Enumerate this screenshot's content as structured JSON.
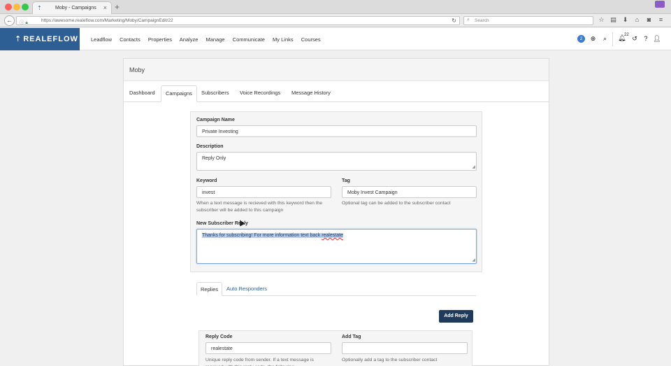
{
  "browser": {
    "tab_title": "Moby - Campaigns",
    "url": "https://awesome.realeflow.com/Marketing/Moby/CampaignEdit/22",
    "search_placeholder": "Search",
    "icons": [
      "star-icon",
      "reader-icon",
      "download-icon",
      "home-icon",
      "pocket-icon",
      "menu-icon"
    ]
  },
  "app": {
    "logo": "REALEFLOW",
    "nav": [
      "Leadflow",
      "Contacts",
      "Properties",
      "Analyze",
      "Manage",
      "Communicate",
      "My Links",
      "Courses"
    ],
    "badge_count": "2",
    "notification_count": "22"
  },
  "page": {
    "title": "Moby",
    "tabs": [
      "Dashboard",
      "Campaigns",
      "Subscribers",
      "Voice Recordings",
      "Message History"
    ],
    "active_tab": "Campaigns"
  },
  "form": {
    "campaign_name_label": "Campaign Name",
    "campaign_name_value": "Private Investing",
    "description_label": "Description",
    "description_value": "Reply Only",
    "keyword_label": "Keyword",
    "keyword_value": "invest",
    "keyword_hint": "When a text message is recieved with this keyword then the subscriber will be added to this campaign",
    "tag_label": "Tag",
    "tag_value": "Moby Invest Campaign",
    "tag_hint": "Optional tag can be added to the subscriber contact",
    "new_subscriber_reply_label": "New Subscriber Reply",
    "new_subscriber_reply_value_a": "Thanks for subscribing! For more information text back ",
    "new_subscriber_reply_value_b": "realestate"
  },
  "subtabs": [
    "Replies",
    "Auto Responders"
  ],
  "add_reply_label": "Add Reply",
  "reply": {
    "code_label": "Reply Code",
    "code_value": "realestate",
    "code_hint": "Unique reply code from sender. If a text message is received with this reply code, the following",
    "add_tag_label": "Add Tag",
    "add_tag_value": "",
    "add_tag_hint": "Optionally add a tag to the subscriber contact"
  }
}
